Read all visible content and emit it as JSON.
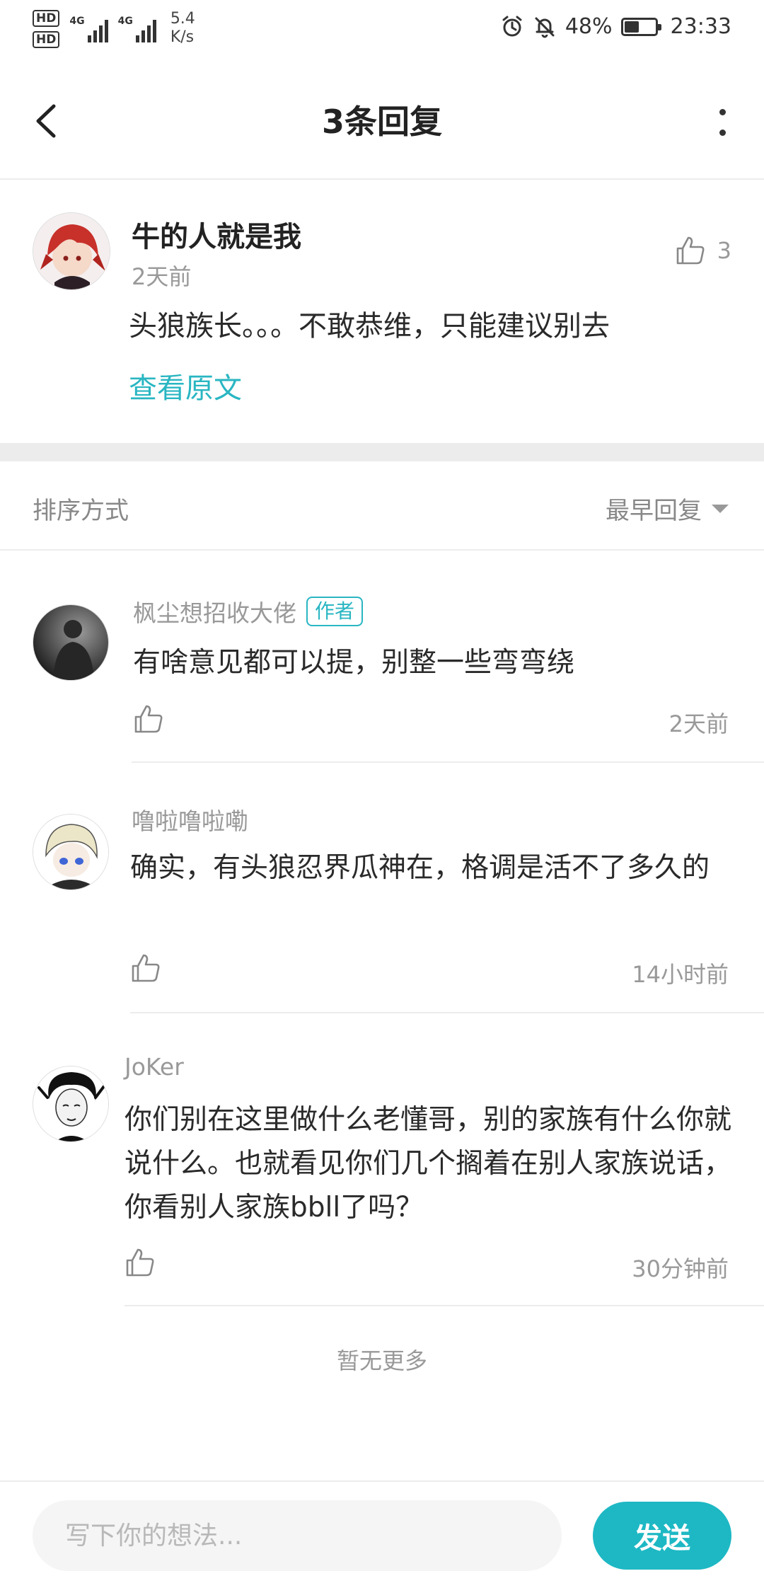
{
  "status_bar": {
    "sim1": "HD",
    "sim2": "HD",
    "net1": "4G",
    "net2": "4G",
    "speed_value": "5.4",
    "speed_unit": "K/s",
    "battery_text": "48%",
    "battery_level": 0.48,
    "time": "23:33"
  },
  "header": {
    "title": "3条回复",
    "back_icon": "chevron-left-icon",
    "more_icon": "more-vertical-icon"
  },
  "post": {
    "author": "牛的人就是我",
    "time": "2天前",
    "like_count": "3",
    "text": "头狼族长。。。不敢恭维，只能建议别去",
    "view_original": "查看原文"
  },
  "sort": {
    "label": "排序方式",
    "selected": "最早回复"
  },
  "replies": [
    {
      "name": "枫尘想招收大佬",
      "badge": "作者",
      "text": "有啥意见都可以提，别整一些弯弯绕",
      "time": "2天前"
    },
    {
      "name": "噜啦噜啦嘞",
      "text": "确实，有头狼忍界瓜神在，格调是活不了多久的",
      "time": "14小时前"
    },
    {
      "name": "JoKer",
      "text": "你们别在这里做什么老懂哥，别的家族有什么你就说什么。也就看见你们几个搁着在别人家族说话，你看别人家族bbll了吗？",
      "time": "30分钟前"
    }
  ],
  "footer": {
    "no_more": "暂无更多",
    "input_placeholder": "写下你的想法...",
    "send_label": "发送"
  },
  "colors": {
    "accent": "#1db8c4",
    "link": "#29b6c2",
    "muted_text": "#999999",
    "divider": "#ececec"
  }
}
